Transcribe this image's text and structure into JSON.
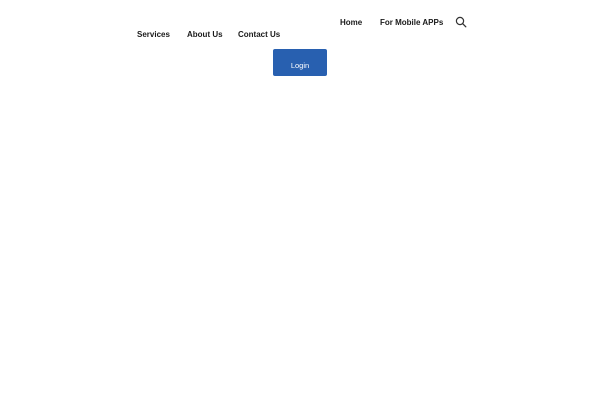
{
  "nav": {
    "home": "Home",
    "for_mobile_apps": "For Mobile APPs",
    "services": "Services",
    "about_us": "About Us",
    "contact_us": "Contact Us",
    "search_icon": "search-icon"
  },
  "login": {
    "label": "Login",
    "color": "#2860b0"
  }
}
